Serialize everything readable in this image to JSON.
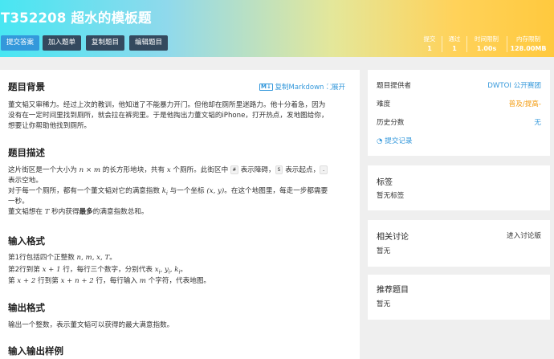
{
  "problem": {
    "title": "T352208 超水的模板题"
  },
  "toolbar": {
    "submit": "提交答案",
    "add_list": "加入题单",
    "copy": "复制题目",
    "edit": "编辑题目"
  },
  "stats": [
    {
      "key": "提交",
      "value": "1"
    },
    {
      "key": "通过",
      "value": "1"
    },
    {
      "key": "时间限制",
      "value": "1.00s"
    },
    {
      "key": "内存限制",
      "value": "128.00MB"
    }
  ],
  "content": {
    "copy_md": "复制Markdown",
    "expand": "展开",
    "bg_title": "题目背景",
    "bg_l1": "董文韬又审稀力。经过上次的教训，他知道了不能暴力开门。但他却在厕所里迷路力。他十分着急，因为",
    "bg_l2": "没有在一定时间里找到厕所，就会拉在裤兜里。于是他掏出力董文韬的iPhone，打开热点，发地图给你，",
    "bg_l3": "想要让你帮助他找到厕所。",
    "desc_title": "题目描述",
    "d1_a": "这片街区是一个大小为 ",
    "d1_m": "n × m",
    "d1_b": " 的长方形地块，共有 ",
    "d1_x": "x",
    "d1_c": " 个厕所。此街区中 ",
    "chip1": "#",
    "d1_d": " 表示障碍，",
    "chip2": "S",
    "d1_e": " 表示起点，",
    "chip3": ".",
    "d2": "表示空地。",
    "d3_a": "对于每一个厕所，都有一个董文韬对它的满意指数 ",
    "d3_k": "k",
    "d3_ki": "i",
    "d3_b": " 与一个坐标 ",
    "d3_xy": "(x, y)",
    "d3_c": "。在这个地图里，每走一步都需要",
    "d4": "一秒。",
    "d5_a": "董文韬想在 ",
    "d5_t": "T",
    "d5_b": " 秒内获得",
    "d5_bold": "最多",
    "d5_c": "的满意指数总和。",
    "in_title": "输入格式",
    "i1_a": "第1行包括四个正整数 ",
    "i1_m": "n, m, x, T",
    "i1_b": "。",
    "i2_a": "第2行到第 ",
    "i2_m": "x + 1",
    "i2_b": " 行，每行三个数字，分别代表 ",
    "i2_m2": "x",
    "i2_s1": "i",
    "i2_m3": ", y",
    "i2_s2": "i",
    "i2_m4": ", k",
    "i2_s3": "i",
    "i2_c": "。",
    "i3_a": "第 ",
    "i3_m": "x + 2",
    "i3_b": " 行到第 ",
    "i3_m2": "x + n + 2",
    "i3_c": " 行，每行输入 ",
    "i3_m3": "m",
    "i3_d": " 个字符，代表地图。",
    "out_title": "输出格式",
    "o1": "输出一个整数，表示董文韬可以获得的最大满意指数。",
    "sample_title": "输入输出样例"
  },
  "sidebar": {
    "provider_label": "题目提供者",
    "provider_value": "DWTOI 公开赛团",
    "difficulty_label": "难度",
    "difficulty_value": "普及/提高-",
    "difficulty_color": "#f39c12",
    "history_label": "历史分数",
    "history_value": "无",
    "submissions_link": "提交记录",
    "tags_title": "标签",
    "tags_value": "暂无标签",
    "discuss_title": "相关讨论",
    "discuss_link": "进入讨论版",
    "discuss_value": "暂无",
    "recommend_title": "推荐题目",
    "recommend_value": "暂无"
  }
}
